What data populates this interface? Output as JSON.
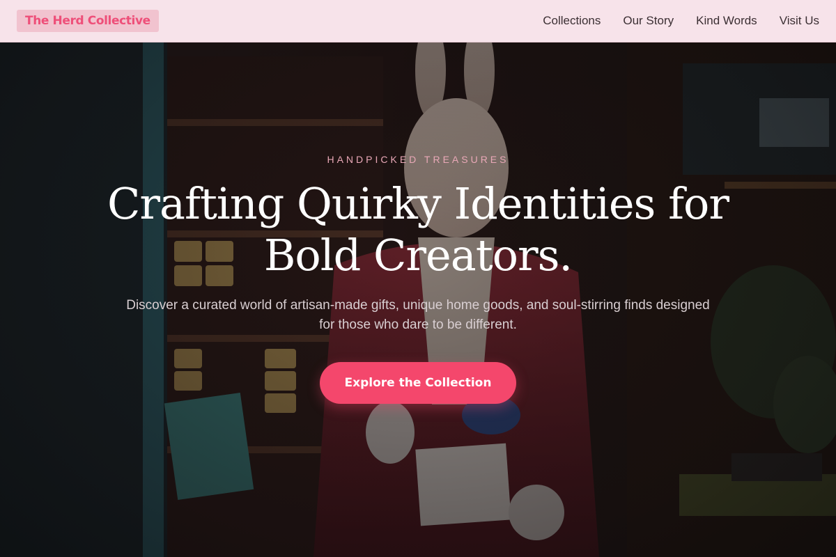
{
  "brand": {
    "name": "The Herd Collective"
  },
  "nav": {
    "links": [
      {
        "label": "Collections"
      },
      {
        "label": "Our Story"
      },
      {
        "label": "Kind Words"
      },
      {
        "label": "Visit Us"
      }
    ]
  },
  "hero": {
    "eyebrow": "HANDPICKED TREASURES",
    "headline": "Crafting Quirky Identities for Bold Creators.",
    "subtitle": "Discover a curated world of artisan-made gifts, unique home goods, and soul-stirring finds designed for those who dare to be different.",
    "cta_label": "Explore the Collection"
  },
  "colors": {
    "accent": "#f4476c",
    "brand_text": "#ee4f79",
    "nav_bg": "#f7e3ea",
    "eyebrow": "#e9a8b7"
  }
}
